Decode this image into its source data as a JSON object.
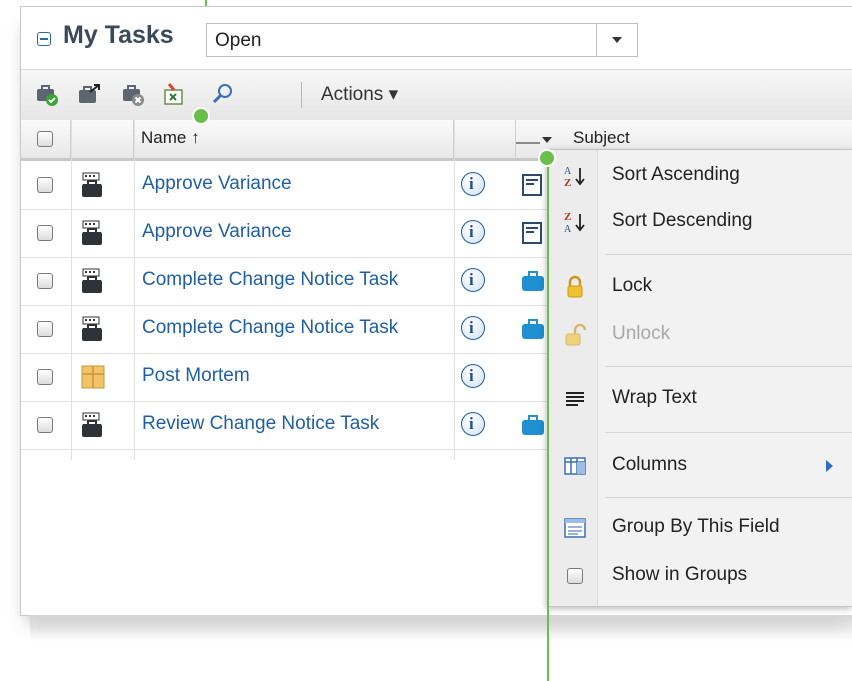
{
  "panel": {
    "title": "My Tasks",
    "filter": {
      "value": "Open"
    }
  },
  "toolbar": {
    "actions_label": "Actions ▾",
    "icons": [
      "complete-task-icon",
      "send-task-icon",
      "cancel-task-icon",
      "export-excel-icon",
      "search-icon"
    ]
  },
  "grid": {
    "headers": {
      "name": "Name ↑",
      "subject": "Subject"
    },
    "rows": [
      {
        "name": "Approve Variance",
        "type_icon": "workflow-task-icon",
        "subject_icon": "form-icon"
      },
      {
        "name": "Approve Variance",
        "type_icon": "workflow-task-icon",
        "subject_icon": "form-icon"
      },
      {
        "name": "Complete Change Notice Task",
        "type_icon": "workflow-task-icon",
        "subject_icon": "briefcase-icon"
      },
      {
        "name": "Complete Change Notice Task",
        "type_icon": "workflow-task-icon",
        "subject_icon": "briefcase-icon"
      },
      {
        "name": "Post Mortem",
        "type_icon": "project-task-icon",
        "subject_icon": ""
      },
      {
        "name": "Review Change Notice Task",
        "type_icon": "workflow-task-icon",
        "subject_icon": "briefcase-icon"
      }
    ]
  },
  "column_menu": {
    "items": [
      {
        "label": "Sort Ascending",
        "icon": "sort-ascending-icon",
        "enabled": true
      },
      {
        "label": "Sort Descending",
        "icon": "sort-descending-icon",
        "enabled": true
      },
      {
        "label": "Lock",
        "icon": "lock-icon",
        "enabled": true
      },
      {
        "label": "Unlock",
        "icon": "unlock-icon",
        "enabled": false
      },
      {
        "label": "Wrap Text",
        "icon": "wrap-text-icon",
        "enabled": true
      },
      {
        "label": "Columns",
        "icon": "columns-icon",
        "enabled": true,
        "submenu": true
      },
      {
        "label": "Group By This Field",
        "icon": "group-by-icon",
        "enabled": true
      },
      {
        "label": "Show in Groups",
        "icon": "checkbox-icon",
        "enabled": true
      }
    ]
  },
  "colors": {
    "callout": "#6abf4b",
    "link": "#1f5fa6",
    "accent": "#2c6ec0"
  }
}
